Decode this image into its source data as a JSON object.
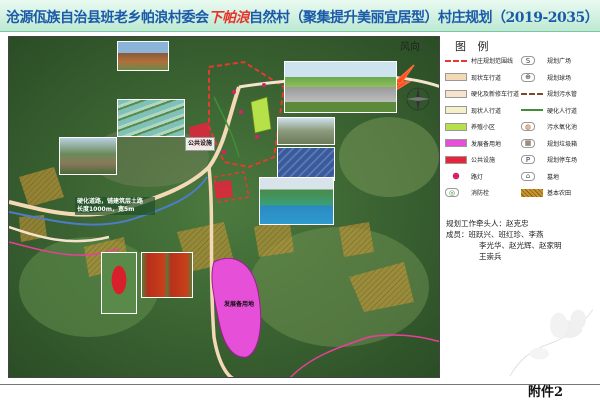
{
  "title": {
    "part1": "沧源佤族自治县班老乡帕浪村委会",
    "highlight": "下帕浪",
    "part2": "自然村（聚集提升美丽宜居型）村庄规划（2019-2035）"
  },
  "compass_label": "风向",
  "legend": {
    "title": "图 例",
    "items": [
      {
        "label": "村庄规划范围线",
        "kind": "boundary",
        "color": "#e53b2e"
      },
      {
        "label": "规划广场",
        "kind": "symbol",
        "symbol": "S",
        "color": "#333333"
      },
      {
        "label": "现状车行道",
        "kind": "fill",
        "color": "#f4d9b6"
      },
      {
        "label": "规划球场",
        "kind": "symbol",
        "symbol": "⊕",
        "color": "#333333"
      },
      {
        "label": "硬化及新修车行道",
        "kind": "fill",
        "color": "#f5e3ce"
      },
      {
        "label": "规划污水管",
        "kind": "dashed",
        "color": "#7a4a2a"
      },
      {
        "label": "现状人行道",
        "kind": "fill",
        "color": "#f6f0c8"
      },
      {
        "label": "硬化人行道",
        "kind": "line",
        "color": "#3f8f3a"
      },
      {
        "label": "养殖小区",
        "kind": "fill",
        "color": "#b6e14a"
      },
      {
        "label": "污水氧化池",
        "kind": "symbol",
        "symbol": "◍",
        "color": "#b54a1c"
      },
      {
        "label": "发展备用地",
        "kind": "fill",
        "color": "#e64fd8"
      },
      {
        "label": "规划垃圾箱",
        "kind": "symbol",
        "symbol": "▦",
        "color": "#6b4a2a"
      },
      {
        "label": "公共设施",
        "kind": "fill",
        "color": "#e8233c"
      },
      {
        "label": "规划停车场",
        "kind": "symbol",
        "symbol": "P",
        "color": "#333333"
      },
      {
        "label": "路灯",
        "kind": "dot",
        "color": "#d8206b"
      },
      {
        "label": "墓地",
        "kind": "symbol",
        "symbol": "⌂",
        "color": "#555555"
      },
      {
        "label": "消防栓",
        "kind": "symbol",
        "symbol": "◎",
        "color": "#3a8a2a"
      },
      {
        "label": "基本农田",
        "kind": "hatch",
        "color": "#c8962a"
      }
    ]
  },
  "staff": {
    "leader_label": "规划工作牵头人：",
    "leader": "赵克忠",
    "members_label": "成员：",
    "members_line1": "班跃兴、班红珍、李燕",
    "members_line2": "李光华、赵光辉、赵家明",
    "members_line3": "王崇兵"
  },
  "map_labels": {
    "road_note": "硬化道路，铺建筑层土路\n长度1000m，宽5m",
    "public_facility": "公共设施",
    "dev_reserve": "发展备用地"
  },
  "footer": {
    "annex": "附件2"
  }
}
